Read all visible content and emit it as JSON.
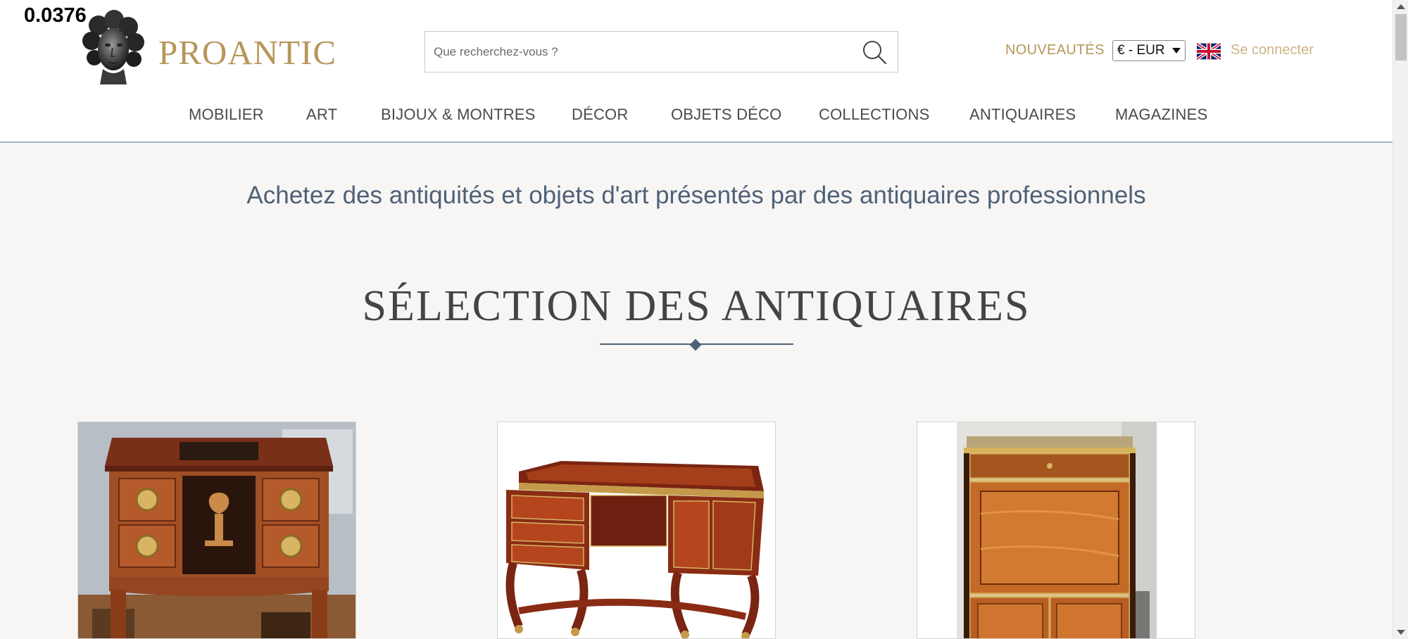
{
  "overlay": {
    "value": "0.0376"
  },
  "brand": {
    "logo_text": "PROANTIC",
    "logo_icon": "bust-logo-icon"
  },
  "search": {
    "placeholder": "Que recherchez-vous ?",
    "value": "",
    "icon": "search-icon"
  },
  "header_links": {
    "nouveautes": "NOUVEAUTÉS",
    "currency_selected": "€ - EUR",
    "language_icon": "uk-flag-icon",
    "login": "Se connecter"
  },
  "nav": {
    "items": [
      {
        "label": "MOBILIER"
      },
      {
        "label": "ART"
      },
      {
        "label": "BIJOUX & MONTRES"
      },
      {
        "label": "DÉCOR"
      },
      {
        "label": "OBJETS DÉCO"
      },
      {
        "label": "COLLECTIONS"
      },
      {
        "label": "ANTIQUAIRES"
      },
      {
        "label": "MAGAZINES"
      }
    ]
  },
  "main": {
    "tagline": "Achetez des antiquités et objets d'art présentés par des antiquaires professionnels",
    "section_title": "SÉLECTION DES ANTIQUAIRES",
    "cards": [
      {
        "image": "marquetry-commode-image"
      },
      {
        "image": "boulle-desk-image"
      },
      {
        "image": "secretaire-cabinet-image"
      }
    ]
  },
  "colors": {
    "brand_gold": "#b6965a",
    "nav_text": "#4a4a4a",
    "accent_slate": "#4f6178",
    "page_bg": "#f7f6f4"
  }
}
